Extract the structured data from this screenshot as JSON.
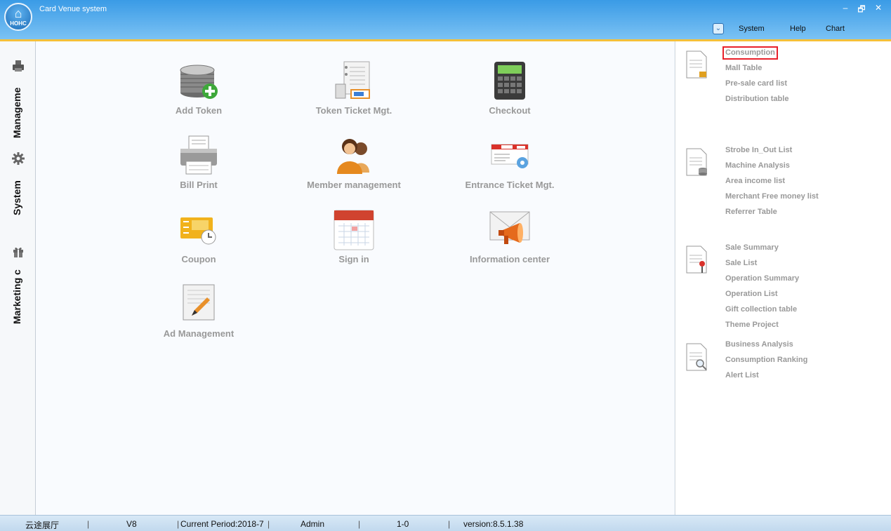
{
  "window": {
    "title": "Card Venue system",
    "logo_text": "HOHC",
    "controls": {
      "minimize": "–",
      "restore": "🗗",
      "close": "✕"
    }
  },
  "menu": {
    "toggle_icon": "circle-chevron-down-icon",
    "items": [
      "System",
      "Help",
      "Chart"
    ]
  },
  "sidebar": {
    "items": [
      {
        "label": "Manageme",
        "icon": "printer-icon"
      },
      {
        "label": "System",
        "icon": "gear-icon"
      },
      {
        "label": "Marketing c",
        "icon": "gift-icon"
      }
    ]
  },
  "tiles": [
    {
      "label": "Add Token",
      "icon": "token-stack-add-icon"
    },
    {
      "label": "Token Ticket Mgt.",
      "icon": "ticket-notebook-icon"
    },
    {
      "label": "Checkout",
      "icon": "calculator-icon"
    },
    {
      "label": "Bill Print",
      "icon": "printer-icon"
    },
    {
      "label": "Member management",
      "icon": "members-icon"
    },
    {
      "label": "Entrance Ticket Mgt.",
      "icon": "entrance-ticket-icon"
    },
    {
      "label": "Coupon",
      "icon": "coupon-clock-icon"
    },
    {
      "label": "Sign in",
      "icon": "calendar-icon"
    },
    {
      "label": "Information center",
      "icon": "envelope-megaphone-icon"
    },
    {
      "label": "Ad Management",
      "icon": "pencil-document-icon"
    }
  ],
  "reports": {
    "groups": [
      {
        "icon": "document-lock-icon",
        "links": [
          "Consumption",
          "Mall Table",
          "Pre-sale card list",
          "Distribution table"
        ]
      },
      {
        "icon": "document-database-icon",
        "links": [
          "Strobe In_Out List",
          "Machine Analysis",
          "Area income list",
          "Merchant Free money list",
          "Referrer Table"
        ]
      },
      {
        "icon": "document-pin-icon",
        "links": [
          "Sale Summary",
          "Sale List",
          "Operation Summary",
          "Operation List",
          "Gift collection table",
          "Theme Project"
        ]
      },
      {
        "icon": "document-search-icon",
        "links": [
          "Business Analysis",
          "Consumption Ranking",
          "Alert List"
        ]
      }
    ],
    "highlighted": "Consumption"
  },
  "status": {
    "venue": "云途展厅",
    "version_label": "V8",
    "period": "Current Period:2018-7",
    "user": "Admin",
    "code": "1-0",
    "version": "version:8.5.1.38"
  },
  "colors": {
    "accent": "#3a9be6",
    "highlight": "#e8212b",
    "stripe": "#f5c03a"
  }
}
